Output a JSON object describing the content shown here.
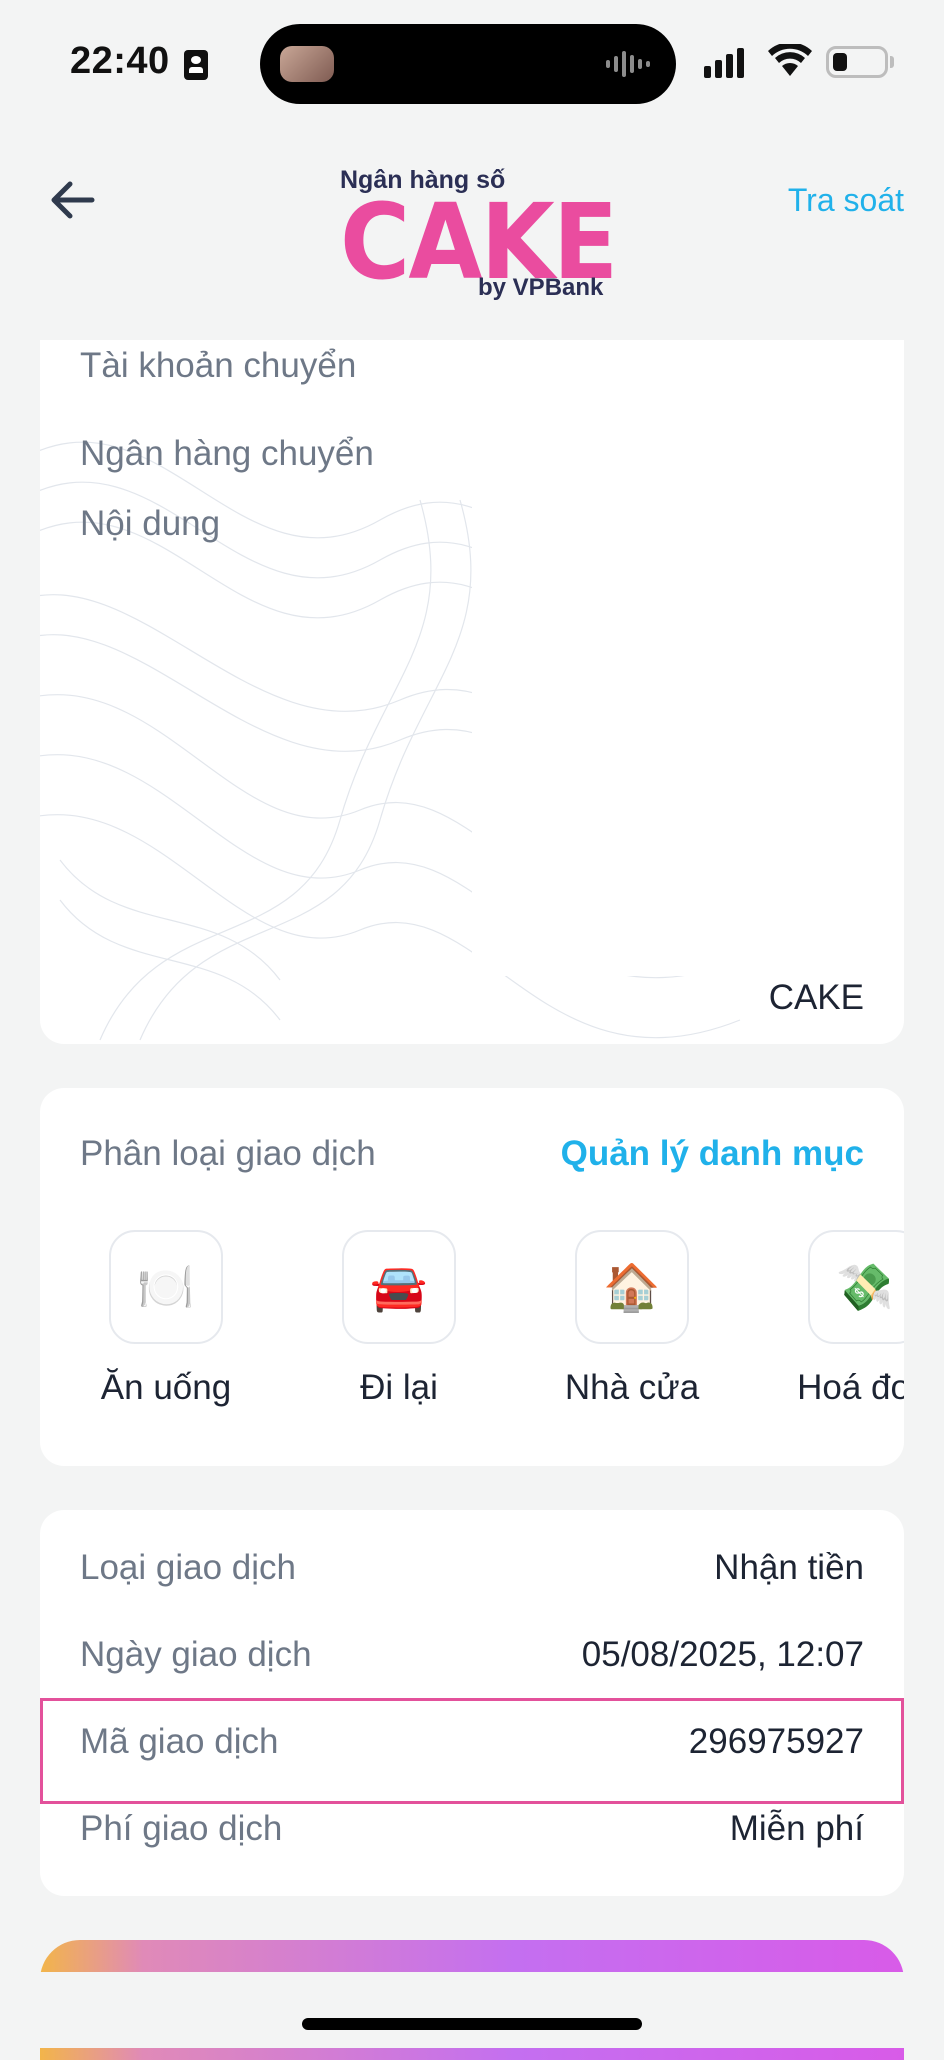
{
  "status_bar": {
    "time": "22:40"
  },
  "header": {
    "brand_top": "Ngân hàng số",
    "brand_main": "CAKE",
    "brand_sub": "by VPBank",
    "action_label": "Tra soát"
  },
  "transfer_card": {
    "rows": [
      {
        "label": "Tài khoản chuyển"
      },
      {
        "label": "Ngân hàng chuyển"
      },
      {
        "label": "Nội dung"
      }
    ],
    "bank_value": "CAKE"
  },
  "category_card": {
    "title": "Phân loại giao dịch",
    "manage_label": "Quản lý danh mục",
    "categories": [
      {
        "label": "Ăn uống",
        "icon": "🍽️"
      },
      {
        "label": "Đi lại",
        "icon": "🚘"
      },
      {
        "label": "Nhà cửa",
        "icon": "🏠"
      },
      {
        "label": "Hoá đơn",
        "icon": "💸"
      }
    ]
  },
  "details_card": {
    "rows": [
      {
        "label": "Loại giao dịch",
        "value": "Nhận tiền"
      },
      {
        "label": "Ngày giao dịch",
        "value": "05/08/2025, 12:07"
      },
      {
        "label": "Mã giao dịch",
        "value": "296975927"
      },
      {
        "label": "Phí giao dịch",
        "value": "Miễn phí"
      }
    ]
  },
  "colors": {
    "accent": "#20b1ea",
    "brand": "#ea4c9f",
    "highlight": "#e3519b"
  }
}
